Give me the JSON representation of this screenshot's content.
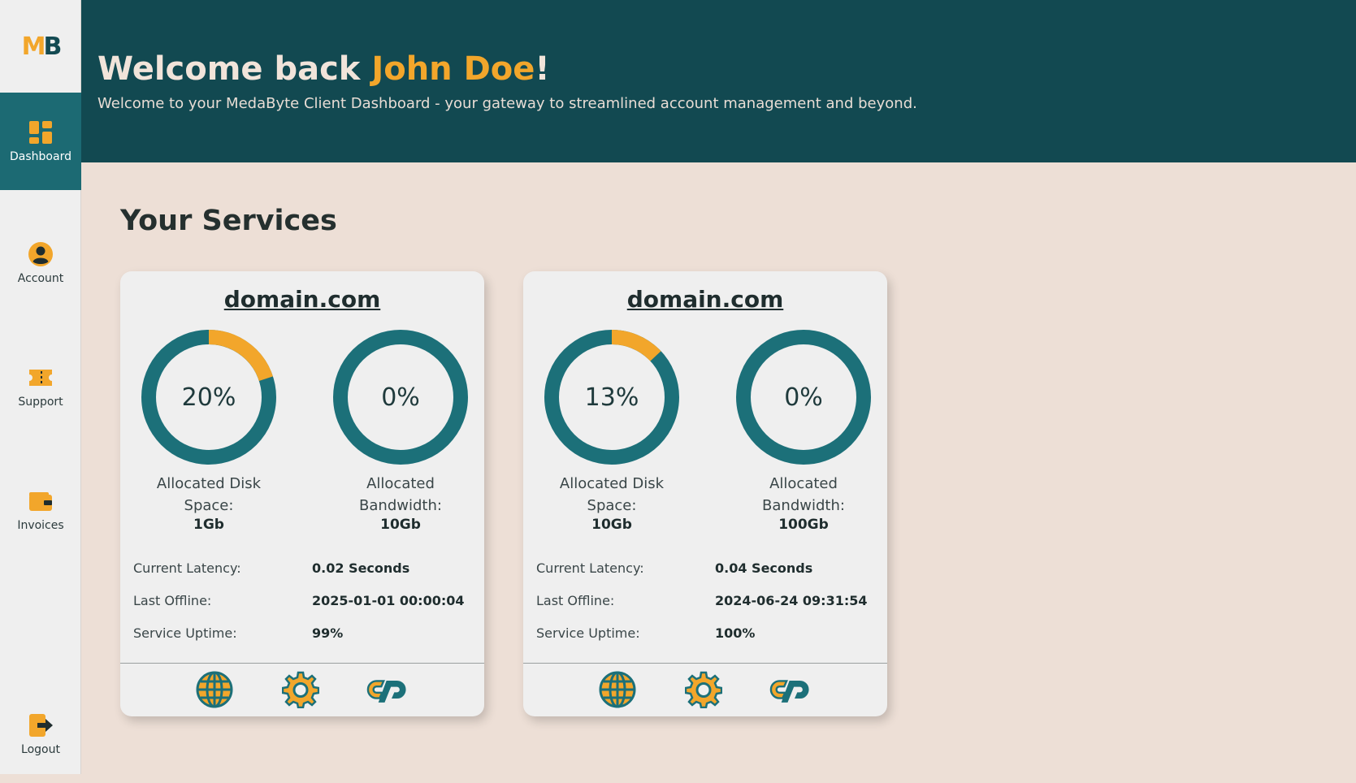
{
  "logo": {
    "text_m": "M",
    "text_b": "B"
  },
  "sidebar": {
    "items": [
      {
        "label": "Dashboard",
        "icon": "dashboard-icon",
        "active": true
      },
      {
        "label": "Account",
        "icon": "account-icon",
        "active": false
      },
      {
        "label": "Support",
        "icon": "support-ticket-icon",
        "active": false
      },
      {
        "label": "Invoices",
        "icon": "wallet-icon",
        "active": false
      },
      {
        "label": "Logout",
        "icon": "logout-icon",
        "active": false
      }
    ]
  },
  "header": {
    "welcome_prefix": "Welcome back ",
    "user_name": "John Doe",
    "welcome_suffix": "!",
    "subtitle": "Welcome to your MedaByte Client Dashboard - your gateway to streamlined account management and beyond."
  },
  "main": {
    "section_title": "Your Services",
    "services": [
      {
        "domain": "domain.com",
        "disk": {
          "percent": 20,
          "percent_label": "20%",
          "label": "Allocated Disk Space:",
          "amount": "1Gb"
        },
        "bandwidth": {
          "percent": 0,
          "percent_label": "0%",
          "label": "Allocated Bandwidth:",
          "amount": "10Gb"
        },
        "stats": [
          {
            "label": "Current Latency:",
            "value": "0.02 Seconds"
          },
          {
            "label": "Last Offline:",
            "value": "2025-01-01 00:00:04"
          },
          {
            "label": "Service Uptime:",
            "value": "99%"
          }
        ],
        "actions": [
          "globe-icon",
          "gear-icon",
          "cpanel-icon"
        ]
      },
      {
        "domain": "domain.com",
        "disk": {
          "percent": 13,
          "percent_label": "13%",
          "label": "Allocated Disk Space:",
          "amount": "10Gb"
        },
        "bandwidth": {
          "percent": 0,
          "percent_label": "0%",
          "label": "Allocated Bandwidth:",
          "amount": "100Gb"
        },
        "stats": [
          {
            "label": "Current Latency:",
            "value": "0.04 Seconds"
          },
          {
            "label": "Last Offline:",
            "value": "2024-06-24 09:31:54"
          },
          {
            "label": "Service Uptime:",
            "value": "100%"
          }
        ],
        "actions": [
          "globe-icon",
          "gear-icon",
          "cpanel-icon"
        ]
      }
    ]
  },
  "colors": {
    "primary": "#124951",
    "ring": "#1c7079",
    "accent": "#f2a62b",
    "background": "#eddfd6",
    "card": "#efefef"
  }
}
